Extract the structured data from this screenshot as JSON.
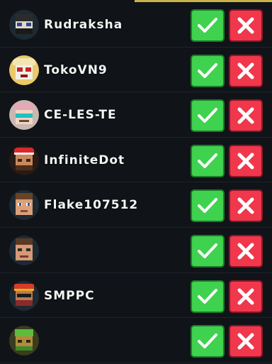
{
  "requests": [
    {
      "name": "Rudraksha",
      "avatar_icon": "avatar-icon"
    },
    {
      "name": "TokoVN9",
      "avatar_icon": "avatar-icon"
    },
    {
      "name": "CE-LES-TE",
      "avatar_icon": "avatar-icon"
    },
    {
      "name": "InfiniteDot",
      "avatar_icon": "avatar-icon"
    },
    {
      "name": "Flake107512",
      "avatar_icon": "avatar-icon"
    },
    {
      "name": "",
      "avatar_icon": "avatar-icon"
    },
    {
      "name": "SMPPC",
      "avatar_icon": "avatar-icon"
    },
    {
      "name": "",
      "avatar_icon": "avatar-icon"
    }
  ],
  "icons": {
    "accept": "check-icon",
    "reject": "cross-icon"
  },
  "colors": {
    "accept": "#3fd24e",
    "reject": "#f0374c",
    "background": "#101418",
    "accent_line": "#c9b24a"
  }
}
